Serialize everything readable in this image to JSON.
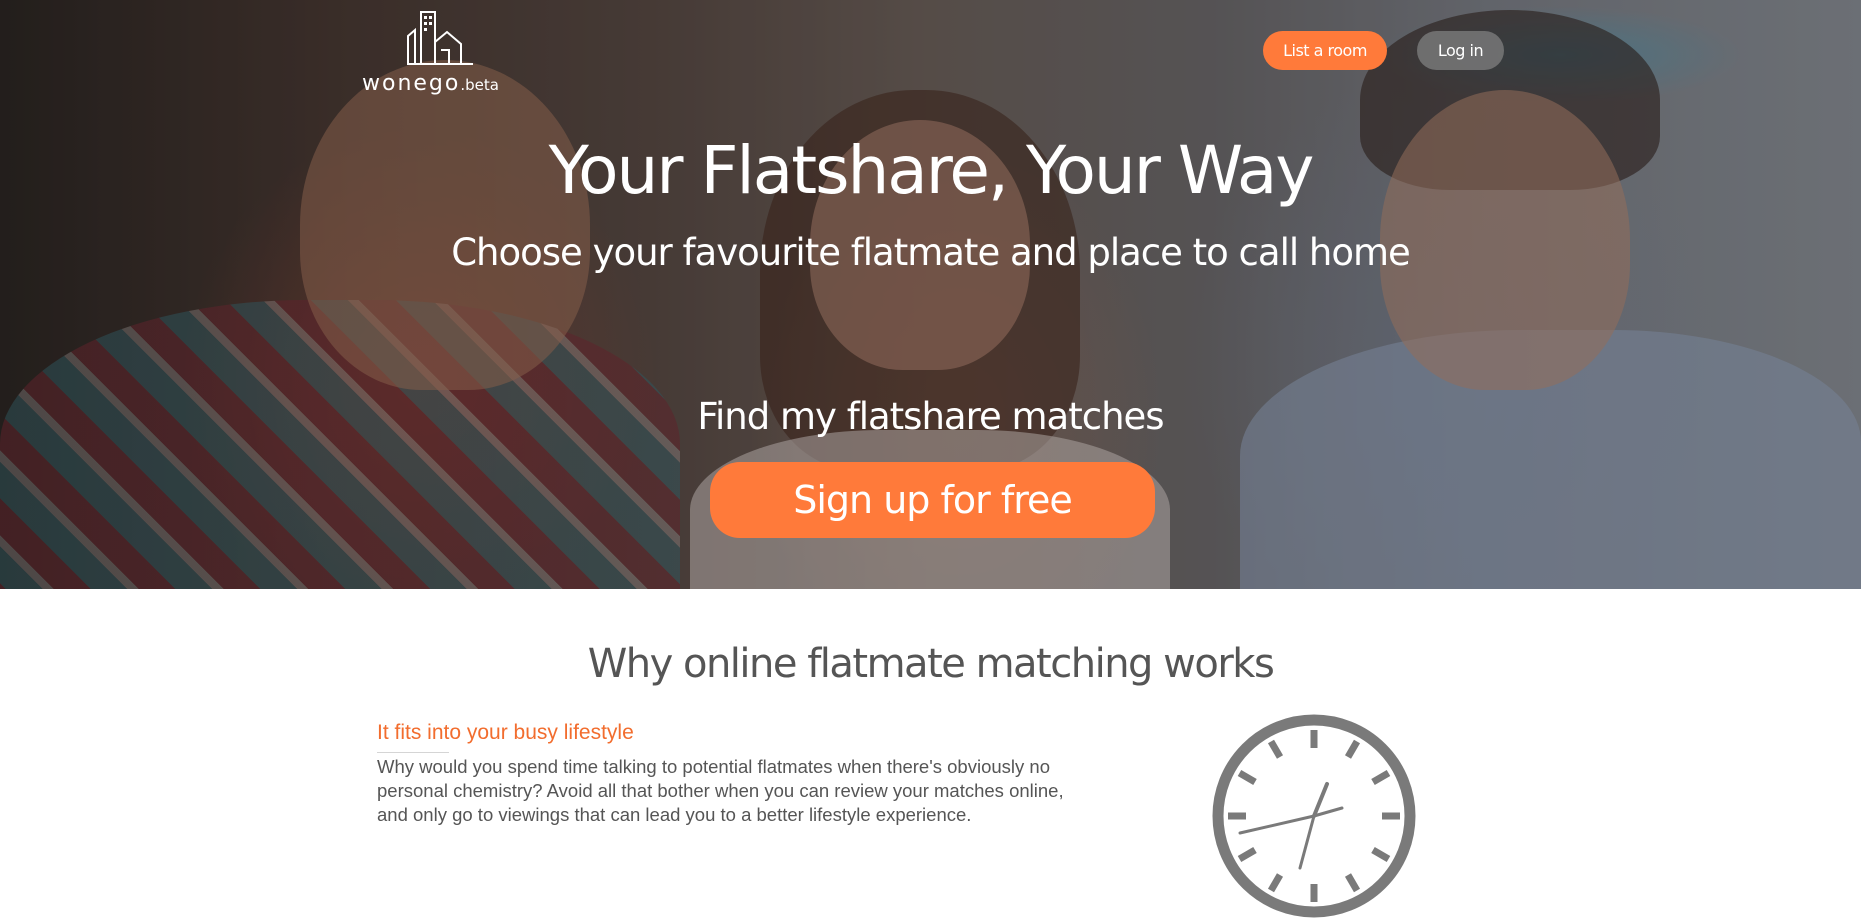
{
  "header": {
    "logo_text": "wonego",
    "logo_suffix": ".beta",
    "list_room_label": "List a room",
    "login_label": "Log in"
  },
  "hero": {
    "title": "Your Flatshare, Your Way",
    "subtitle": "Choose your favourite flatmate and place to call home",
    "cta_heading": "Find my flatshare matches",
    "cta_button": "Sign up for free"
  },
  "features": {
    "section_title": "Why online flatmate matching works",
    "items": [
      {
        "title": "It fits into your busy lifestyle",
        "body": "Why would you spend time talking to potential flatmates when there's obviously no personal chemistry? Avoid all that bother when you can review your matches online, and only go to viewings that can lead you to a better lifestyle experience.",
        "icon": "clock-icon"
      }
    ]
  },
  "colors": {
    "accent": "#ff7a3a",
    "title_orange": "#f26d2e",
    "text_gray": "#555555",
    "icon_gray": "#7a7a7a"
  }
}
